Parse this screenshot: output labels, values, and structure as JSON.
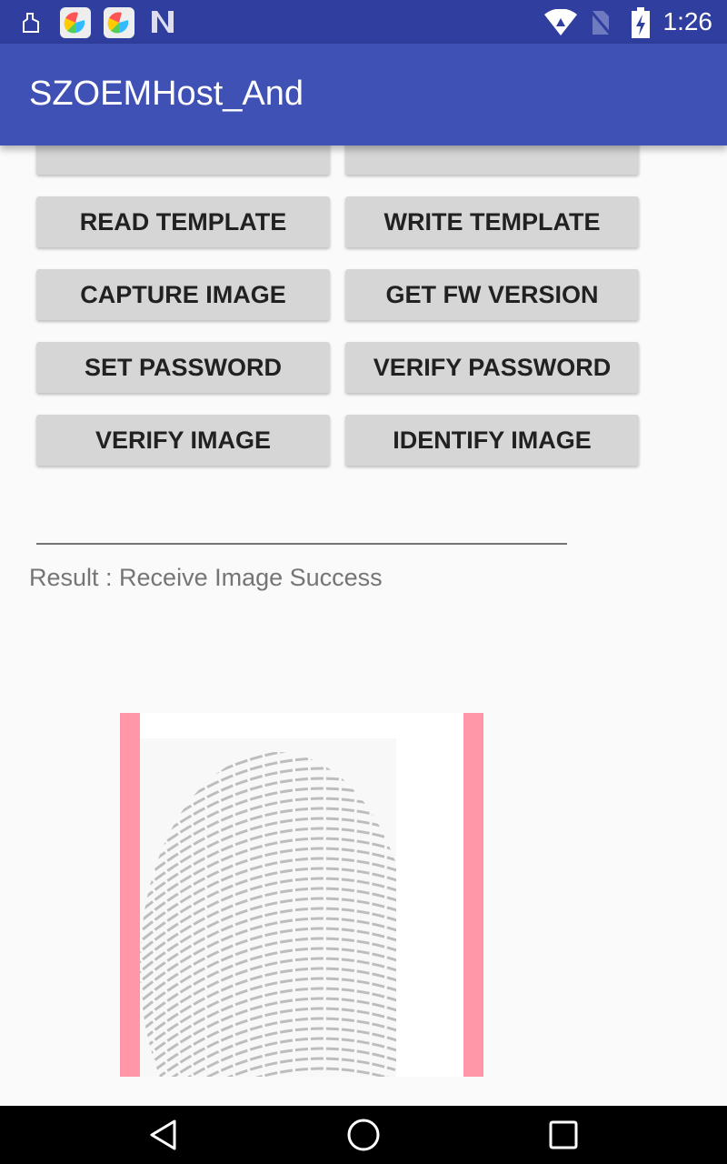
{
  "status_bar": {
    "time": "1:26",
    "icons": [
      "cleaner-icon",
      "app-icon",
      "app-icon",
      "n-icon",
      "wifi-icon",
      "no-sim-icon",
      "battery-charging-icon"
    ]
  },
  "app_bar": {
    "title": "SZOEMHost_And",
    "color": "#3f51b5"
  },
  "buttons": [
    {
      "label": "READ TEMPLATE"
    },
    {
      "label": "WRITE TEMPLATE"
    },
    {
      "label": "CAPTURE IMAGE"
    },
    {
      "label": "GET FW VERSION"
    },
    {
      "label": "SET PASSWORD"
    },
    {
      "label": "VERIFY PASSWORD"
    },
    {
      "label": "VERIFY IMAGE"
    },
    {
      "label": "IDENTIFY IMAGE"
    }
  ],
  "result": {
    "text": "Result : Receive Image Success"
  },
  "image_frame": {
    "border_color": "#ff97a8",
    "content": "fingerprint-image"
  },
  "nav_bar": {
    "icons": [
      "back-icon",
      "home-icon",
      "recents-icon"
    ]
  }
}
